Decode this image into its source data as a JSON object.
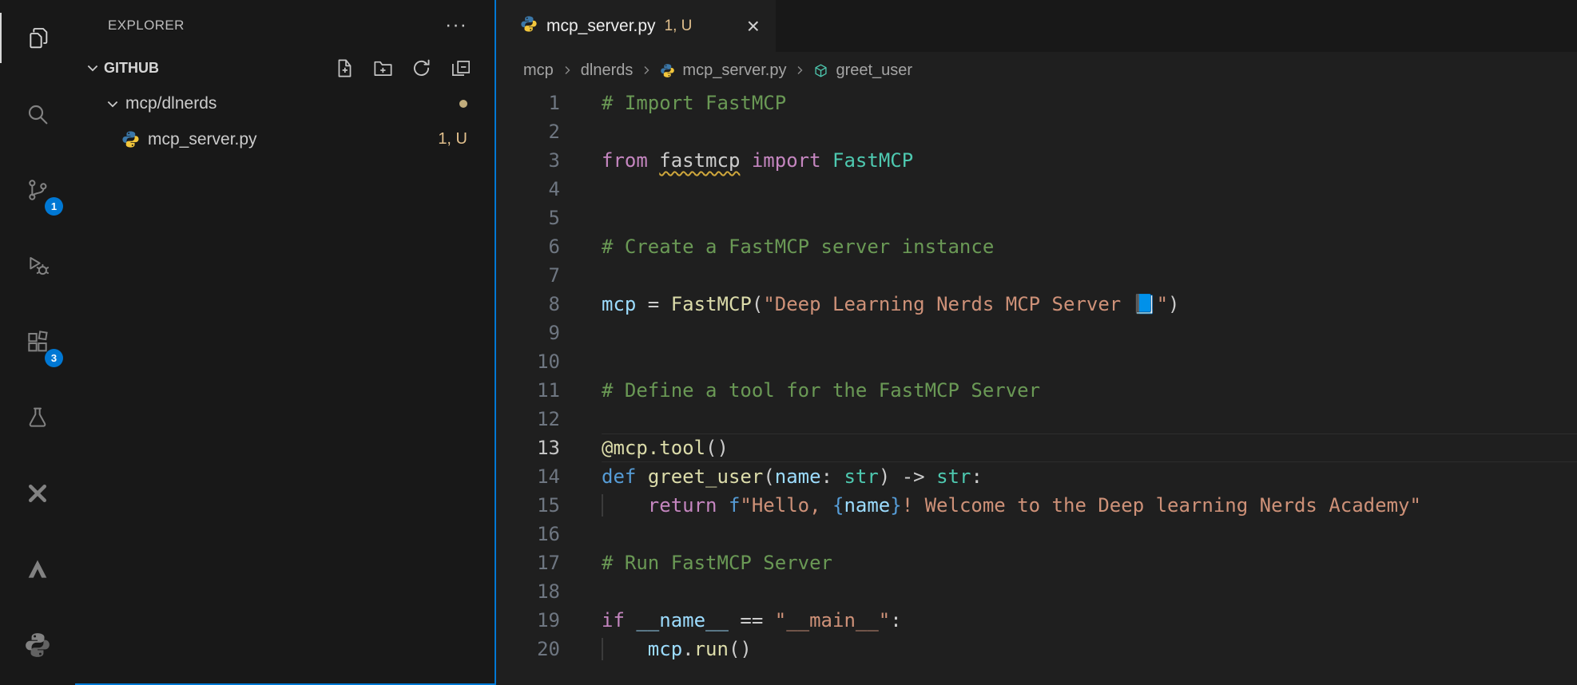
{
  "activity_bar": {
    "source_control_badge": "1",
    "extensions_badge": "3"
  },
  "sidebar": {
    "title": "EXPLORER",
    "more_actions": "···",
    "section_label": "GITHUB",
    "tree": [
      {
        "label": "mcp/dlnerds",
        "type": "folder"
      },
      {
        "label": "mcp_server.py",
        "type": "python-file",
        "badge": "1, U"
      }
    ]
  },
  "editor": {
    "tab": {
      "label": "mcp_server.py",
      "badge": "1, U",
      "close": "×"
    },
    "breadcrumb": {
      "items": [
        "mcp",
        "dlnerds",
        "mcp_server.py",
        "greet_user"
      ]
    },
    "code": {
      "active_line": 13,
      "lines": [
        {
          "n": 1,
          "indent": 0,
          "tokens": [
            [
              "c",
              "# Import FastMCP"
            ]
          ]
        },
        {
          "n": 2,
          "indent": 0,
          "tokens": []
        },
        {
          "n": 3,
          "indent": 0,
          "tokens": [
            [
              "k",
              "from"
            ],
            [
              "p",
              " "
            ],
            [
              "p sq",
              "fastmcp"
            ],
            [
              "p",
              " "
            ],
            [
              "k",
              "import"
            ],
            [
              "p",
              " "
            ],
            [
              "t",
              "FastMCP"
            ]
          ]
        },
        {
          "n": 4,
          "indent": 0,
          "tokens": []
        },
        {
          "n": 5,
          "indent": 0,
          "tokens": []
        },
        {
          "n": 6,
          "indent": 0,
          "tokens": [
            [
              "c",
              "# Create a FastMCP server instance"
            ]
          ]
        },
        {
          "n": 7,
          "indent": 0,
          "tokens": []
        },
        {
          "n": 8,
          "indent": 0,
          "tokens": [
            [
              "v",
              "mcp"
            ],
            [
              "p",
              " = "
            ],
            [
              "f",
              "FastMCP"
            ],
            [
              "p",
              "("
            ],
            [
              "s",
              "\"Deep Learning Nerds MCP Server 📘\""
            ],
            [
              "p",
              ")"
            ]
          ]
        },
        {
          "n": 9,
          "indent": 0,
          "tokens": []
        },
        {
          "n": 10,
          "indent": 0,
          "tokens": []
        },
        {
          "n": 11,
          "indent": 0,
          "tokens": [
            [
              "c",
              "# Define a tool for the FastMCP Server"
            ]
          ]
        },
        {
          "n": 12,
          "indent": 0,
          "tokens": []
        },
        {
          "n": 13,
          "indent": 0,
          "tokens": [
            [
              "f",
              "@mcp.tool"
            ],
            [
              "p",
              "()"
            ]
          ]
        },
        {
          "n": 14,
          "indent": 0,
          "tokens": [
            [
              "b",
              "def"
            ],
            [
              "p",
              " "
            ],
            [
              "f",
              "greet_user"
            ],
            [
              "p",
              "("
            ],
            [
              "v",
              "name"
            ],
            [
              "p",
              ": "
            ],
            [
              "t",
              "str"
            ],
            [
              "p",
              ") -> "
            ],
            [
              "t",
              "str"
            ],
            [
              "p",
              ":"
            ]
          ]
        },
        {
          "n": 15,
          "indent": 4,
          "tokens": [
            [
              "k",
              "return"
            ],
            [
              "p",
              " "
            ],
            [
              "b",
              "f"
            ],
            [
              "s",
              "\"Hello, "
            ],
            [
              "b",
              "{"
            ],
            [
              "v",
              "name"
            ],
            [
              "b",
              "}"
            ],
            [
              "s",
              "! Welcome to the Deep learning Nerds Academy\""
            ]
          ]
        },
        {
          "n": 16,
          "indent": 0,
          "tokens": []
        },
        {
          "n": 17,
          "indent": 0,
          "tokens": [
            [
              "c",
              "# Run FastMCP Server"
            ]
          ]
        },
        {
          "n": 18,
          "indent": 0,
          "tokens": []
        },
        {
          "n": 19,
          "indent": 0,
          "tokens": [
            [
              "k",
              "if"
            ],
            [
              "p",
              " "
            ],
            [
              "v",
              "__name__"
            ],
            [
              "p",
              " == "
            ],
            [
              "s",
              "\"__main__\""
            ],
            [
              "p",
              ":"
            ]
          ]
        },
        {
          "n": 20,
          "indent": 4,
          "tokens": [
            [
              "v",
              "mcp"
            ],
            [
              "p",
              "."
            ],
            [
              "f",
              "run"
            ],
            [
              "p",
              "()"
            ]
          ]
        }
      ]
    }
  }
}
